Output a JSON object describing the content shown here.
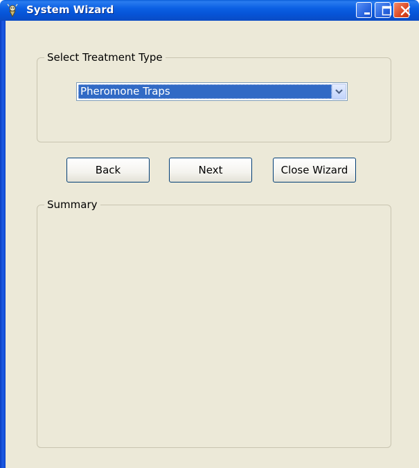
{
  "window": {
    "title": "System Wizard",
    "icons": {
      "app": "app-icon",
      "minimize": "minimize-icon",
      "maximize": "maximize-icon",
      "close": "close-icon"
    }
  },
  "treatment_group": {
    "legend": "Select Treatment Type",
    "selected": "Pheromone Traps",
    "dropdown_icon": "chevron-down-icon"
  },
  "buttons": {
    "back": "Back",
    "next": "Next",
    "close_wizard": "Close Wizard"
  },
  "summary_group": {
    "legend": "Summary"
  },
  "colors": {
    "titlebar": "#0a5fd8",
    "client_bg": "#ece9d8",
    "selection": "#316ac5",
    "close_button": "#dc4a25"
  }
}
